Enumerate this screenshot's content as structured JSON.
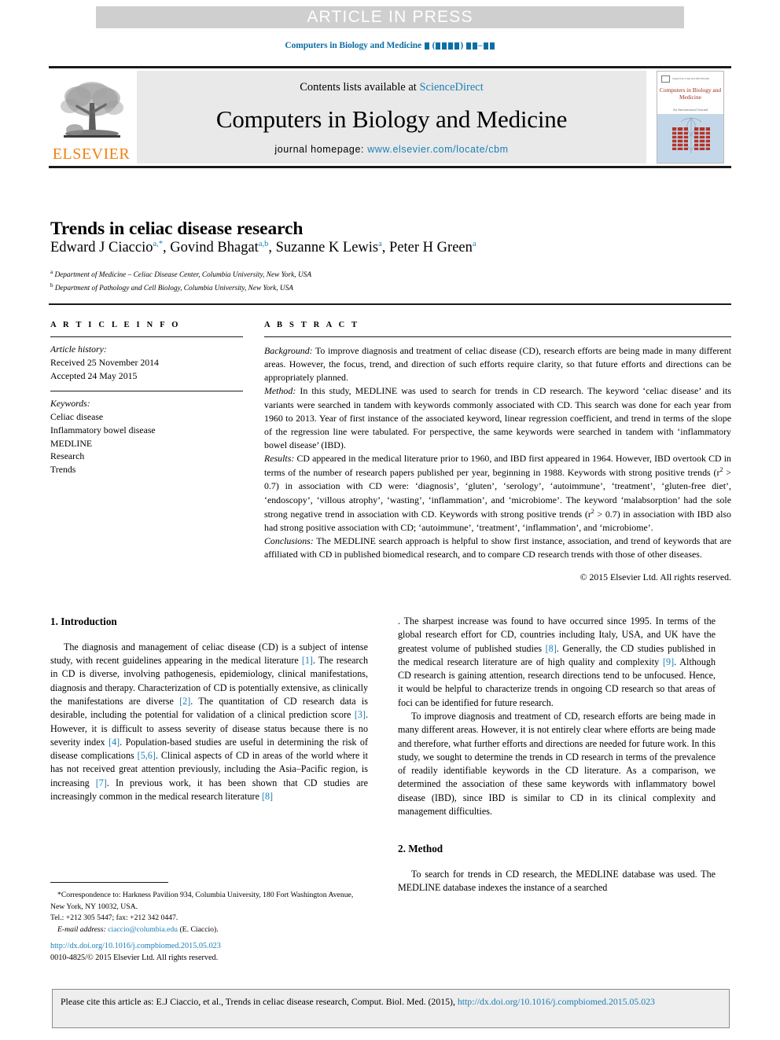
{
  "banner": {
    "text": "ARTICLE IN PRESS"
  },
  "running_head": {
    "journal": "Computers in Biology and Medicine"
  },
  "masthead": {
    "contents_prefix": "Contents lists available at ",
    "sciencedirect": "ScienceDirect",
    "journal_title": "Computers in Biology and Medicine",
    "homepage_label": "journal homepage: ",
    "homepage_url": "www.elsevier.com/locate/cbm",
    "publisher": "ELSEVIER",
    "cover": {
      "title": "Computers in Biology and Medicine",
      "subtitle": "An International Journal",
      "masthead_meta": "Volume 00   No. 0   June 2015   ISSN 0010-4825"
    }
  },
  "article": {
    "title": "Trends in celiac disease research",
    "authors": [
      {
        "name": "Edward J Ciaccio",
        "marks": "a,*"
      },
      {
        "name": "Govind Bhagat",
        "marks": "a,b"
      },
      {
        "name": "Suzanne K Lewis",
        "marks": "a"
      },
      {
        "name": "Peter H Green",
        "marks": "a"
      }
    ],
    "affiliations": [
      {
        "mark": "a",
        "text": "Department of Medicine – Celiac Disease Center, Columbia University, New York, USA"
      },
      {
        "mark": "b",
        "text": "Department of Pathology and Cell Biology, Columbia University, New York, USA"
      }
    ]
  },
  "article_info": {
    "heading": "A R T I C L E   I N F O",
    "history_label": "Article history:",
    "received": "Received 25 November 2014",
    "accepted": "Accepted 24 May 2015",
    "keywords_label": "Keywords:",
    "keywords": [
      "Celiac disease",
      "Inflammatory bowel disease",
      "MEDLINE",
      "Research",
      "Trends"
    ]
  },
  "abstract": {
    "heading": "A B S T R A C T",
    "background_label": "Background:",
    "background_text": " To improve diagnosis and treatment of celiac disease (CD), research efforts are being made in many different areas. However, the focus, trend, and direction of such efforts require clarity, so that future efforts and directions can be appropriately planned.",
    "method_label": "Method:",
    "method_text": " In this study, MEDLINE was used to search for trends in CD research. The keyword ‘celiac disease’ and its variants were searched in tandem with keywords commonly associated with CD. This search was done for each year from 1960 to 2013. Year of first instance of the associated keyword, linear regression coefficient, and trend in terms of the slope of the regression line were tabulated. For perspective, the same keywords were searched in tandem with ‘inflammatory bowel disease’ (IBD).",
    "results_label": "Results:",
    "results_text_1": " CD appeared in the medical literature prior to 1960, and IBD first appeared in 1964. However, IBD overtook CD in terms of the number of research papers published per year, beginning in 1988. Keywords with strong positive trends (r",
    "results_text_2": " > 0.7) in association with CD were: ‘diagnosis’, ‘gluten’, ‘serology’, ‘autoimmune’, ‘treatment’, ‘gluten-free diet’, ‘endoscopy’, ‘villous atrophy’, ‘wasting’, ‘inflammation’, and ‘microbiome’. The keyword ‘malabsorption’ had the sole strong negative trend in association with CD. Keywords with strong positive trends (r",
    "results_text_3": " > 0.7) in association with IBD also had strong positive association with CD; ‘autoimmune’, ‘treatment’, ‘inflammation’, and ‘microbiome’.",
    "conclusions_label": "Conclusions:",
    "conclusions_text": " The MEDLINE search approach is helpful to show first instance, association, and trend of keywords that are affiliated with CD in published biomedical research, and to compare CD research trends with those of other diseases.",
    "superscript_r2": "2",
    "copyright": "© 2015 Elsevier Ltd. All rights reserved."
  },
  "sections": {
    "introduction_heading": "1.  Introduction",
    "method_heading": "2.  Method",
    "intro_p1_a": "The diagnosis and management of celiac disease (CD) is a subject of intense study, with recent guidelines appearing in the medical literature ",
    "intro_p1_b": ". The research in CD is diverse, involving pathogenesis, epidemiology, clinical manifestations, diagnosis and therapy. Characterization of CD is potentially extensive, as clinically the manifestations are diverse ",
    "intro_p1_c": ". The quantitation of CD research data is desirable, including the potential for validation of a clinical prediction score ",
    "intro_p1_d": ". However, it is difficult to assess severity of disease status because there is no severity index ",
    "intro_p1_e": ". Population-based studies are useful in determining the risk of disease complications ",
    "intro_p1_f": ". Clinical aspects of CD in areas of the world where it has not received great attention previously, including the Asia–Pacific region, is increasing ",
    "intro_p1_g": ". In previous work, it has been shown that CD studies are increasingly common in the medical research literature ",
    "intro_p1_h": ". The sharpest increase was found to have occurred since 1995. In terms of the global research effort for CD, countries including Italy, USA, and UK have the greatest volume of published studies ",
    "intro_p1_i": ". Generally, the CD studies published in the medical research literature are of high quality and complexity ",
    "intro_p1_j": ". Although CD research is gaining attention, research directions tend to be unfocused. Hence, it would be helpful to characterize trends in ongoing CD research so that areas of foci can be identified for future research.",
    "intro_p2": "To improve diagnosis and treatment of CD, research efforts are being made in many different areas. However, it is not entirely clear where efforts are being made and therefore, what further efforts and directions are needed for future work. In this study, we sought to determine the trends in CD research in terms of the prevalence of readily identifiable keywords in the CD literature. As a comparison, we determined the association of these same keywords with inflammatory bowel disease (IBD), since IBD is similar to CD in its clinical complexity and management difficulties.",
    "method_p1": "To search for trends in CD research, the MEDLINE database was used. The MEDLINE database indexes the instance of a searched",
    "refs": {
      "r1": "[1]",
      "r2": "[2]",
      "r3": "[3]",
      "r4": "[4]",
      "r56": "[5,6]",
      "r7": "[7]",
      "r8": "[8]",
      "r8b": "[8]",
      "r9": "[9]"
    }
  },
  "footnote": {
    "correspondence": "*Correspondence to: Harkness Pavilion 934, Columbia University, 180 Fort Washington Avenue, New York, NY 10032, USA.",
    "tel": "Tel.: +212 305 5447; fax: +212 342 0447.",
    "email_label": "E-mail address: ",
    "email": "ciaccio@columbia.edu",
    "email_suffix": " (E. Ciaccio).",
    "doi_url": "http://dx.doi.org/10.1016/j.compbiomed.2015.05.023",
    "issn_line": "0010-4825/© 2015 Elsevier Ltd. All rights reserved."
  },
  "cite_box": {
    "text": "Please cite this article as: E.J Ciaccio, et al., Trends in celiac disease research, Comput. Biol. Med. (2015), ",
    "link": "http://dx.doi.org/10.1016/j.compbiomed.2015.05.023"
  },
  "colors": {
    "link": "#1b7fb5",
    "banner_bg": "#cfcfcf",
    "masthead_bg": "#e9e9e9",
    "elsevier_orange": "#f08010",
    "cover_red": "#9c2b22",
    "cover_blue": "#c3d7e8"
  }
}
